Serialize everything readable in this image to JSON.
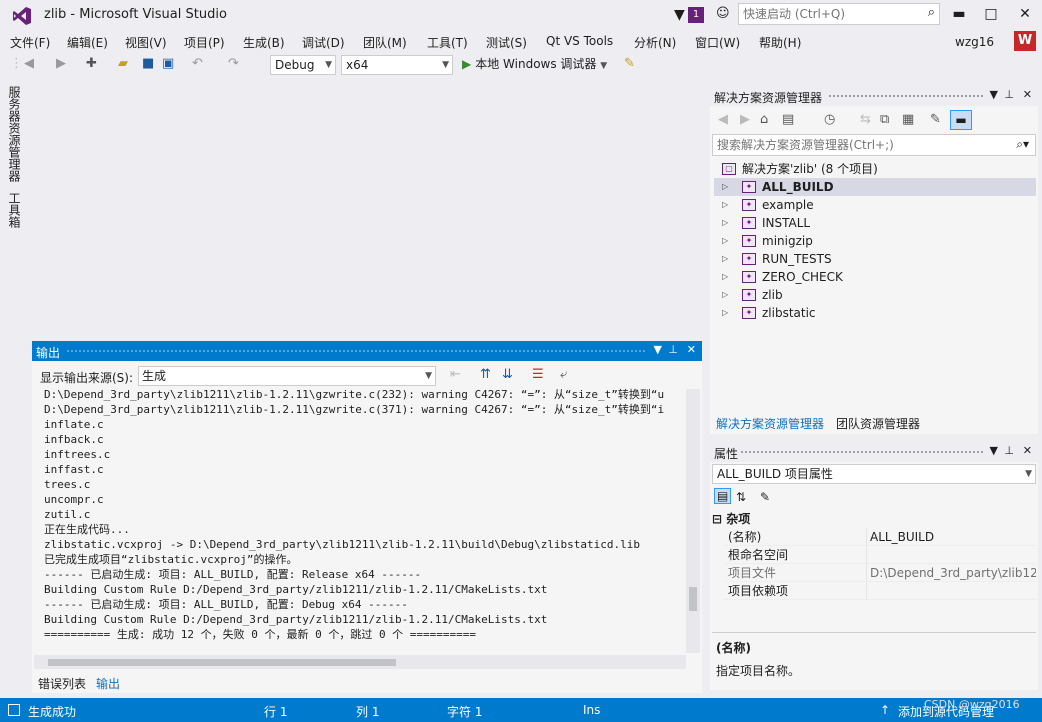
{
  "window": {
    "title": "zlib - Microsoft Visual Studio",
    "notification_count": "1",
    "quick_launch_placeholder": "快速启动 (Ctrl+Q)",
    "minimize": "▬",
    "maximize": "□",
    "close": "✕"
  },
  "menu": {
    "items": [
      "文件(F)",
      "编辑(E)",
      "视图(V)",
      "项目(P)",
      "生成(B)",
      "调试(D)",
      "团队(M)",
      "工具(T)",
      "测试(S)",
      "Qt VS Tools",
      "分析(N)",
      "窗口(W)",
      "帮助(H)"
    ],
    "user": "wzg16",
    "user_badge": "W"
  },
  "toolbar": {
    "config": "Debug",
    "platform": "x64",
    "run_label": "本地 Windows 调试器"
  },
  "left_tabs": [
    "服务器资源管理器",
    "工具箱"
  ],
  "output": {
    "title": "输出",
    "source_label": "显示输出来源(S):",
    "source_value": "生成",
    "lines": [
      "D:\\Depend_3rd_party\\zlib1211\\zlib-1.2.11\\gzwrite.c(232): warning C4267: “=”: 从“size_t”转换到“u",
      "D:\\Depend_3rd_party\\zlib1211\\zlib-1.2.11\\gzwrite.c(371): warning C4267: “=”: 从“size_t”转换到“i",
      "inflate.c",
      "infback.c",
      "inftrees.c",
      "inffast.c",
      "trees.c",
      "uncompr.c",
      "zutil.c",
      "正在生成代码...",
      "zlibstatic.vcxproj -> D:\\Depend_3rd_party\\zlib1211\\zlib-1.2.11\\build\\Debug\\zlibstaticd.lib",
      "已完成生成项目“zlibstatic.vcxproj”的操作。",
      "------ 已启动生成: 项目: ALL_BUILD, 配置: Release x64 ------",
      "Building Custom Rule D:/Depend_3rd_party/zlib1211/zlib-1.2.11/CMakeLists.txt",
      "------ 已启动生成: 项目: ALL_BUILD, 配置: Debug x64 ------",
      "Building Custom Rule D:/Depend_3rd_party/zlib1211/zlib-1.2.11/CMakeLists.txt",
      "========== 生成: 成功 12 个，失败 0 个，最新 0 个，跳过 0 个 =========="
    ],
    "tabs": [
      "错误列表",
      "输出"
    ]
  },
  "solution_explorer": {
    "title": "解决方案资源管理器",
    "search_placeholder": "搜索解决方案资源管理器(Ctrl+;)",
    "solution_label": "解决方案'zlib' (8 个项目)",
    "projects": [
      "ALL_BUILD",
      "example",
      "INSTALL",
      "minigzip",
      "RUN_TESTS",
      "ZERO_CHECK",
      "zlib",
      "zlibstatic"
    ],
    "tabs": [
      "解决方案资源管理器",
      "团队资源管理器"
    ]
  },
  "properties": {
    "title": "属性",
    "object": "ALL_BUILD 项目属性",
    "category": "杂项",
    "rows": [
      {
        "name": "(名称)",
        "value": "ALL_BUILD"
      },
      {
        "name": "根命名空间",
        "value": ""
      },
      {
        "name": "项目文件",
        "value": "D:\\Depend_3rd_party\\zlib12"
      },
      {
        "name": "项目依赖项",
        "value": ""
      }
    ],
    "desc_title": "(名称)",
    "desc_text": "指定项目名称。"
  },
  "statusbar": {
    "status": "生成成功",
    "line": "行 1",
    "col": "列 1",
    "char": "字符 1",
    "mode": "Ins",
    "source_control": "添加到源代码管理",
    "watermark": "CSDN @wzg2016"
  }
}
